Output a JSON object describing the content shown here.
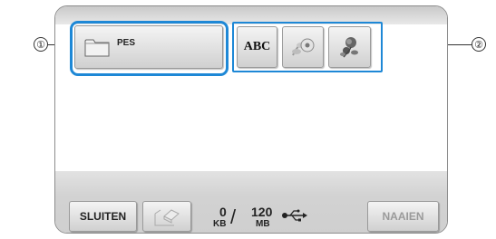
{
  "callouts": {
    "left": "①",
    "right": "②"
  },
  "folder": {
    "label": "PES",
    "icon": "folder-icon"
  },
  "categories": [
    {
      "label": "ABC",
      "icon": "abc-text-icon"
    },
    {
      "icon": "floral-pattern-icon"
    },
    {
      "icon": "rose-pattern-icon"
    }
  ],
  "footer": {
    "close_label": "SLUITEN",
    "memory_used_value": "0",
    "memory_used_unit": "KB",
    "memory_free_value": "120",
    "memory_free_unit": "MB",
    "separator": "/",
    "sew_label": "NAAIEN"
  },
  "colors": {
    "highlight": "#1e88d6"
  }
}
